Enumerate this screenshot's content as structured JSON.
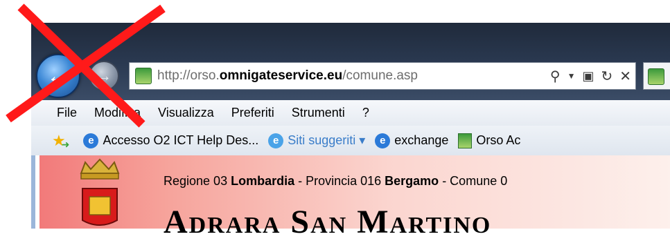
{
  "browser": {
    "address_bar": {
      "url_prefix": "http://orso.",
      "url_domain": "omnigateservice.eu",
      "url_path": "/comune.asp"
    },
    "menu": [
      "File",
      "Modifica",
      "Visualizza",
      "Preferiti",
      "Strumenti",
      "?"
    ],
    "favorites": [
      {
        "label": "Accesso  O2 ICT Help Des...",
        "icon": "ie-page-icon"
      },
      {
        "label": "Siti suggeriti ▾",
        "icon": "ie-globe-icon"
      },
      {
        "label": "exchange",
        "icon": "ie-page-icon"
      },
      {
        "label": "Orso Ac",
        "icon": "orso-site-icon"
      }
    ]
  },
  "page": {
    "region_label": "Regione 03 ",
    "region": "Lombardia",
    "province_label": " - Provincia 016 ",
    "province": "Bergamo",
    "comune_label": "  - Comune 0",
    "title": "Adrara San Martino"
  },
  "colors": {
    "overlay_x": "#ff1a1a",
    "chrome": "#2b3a52",
    "page_band": "#f27a7a"
  }
}
